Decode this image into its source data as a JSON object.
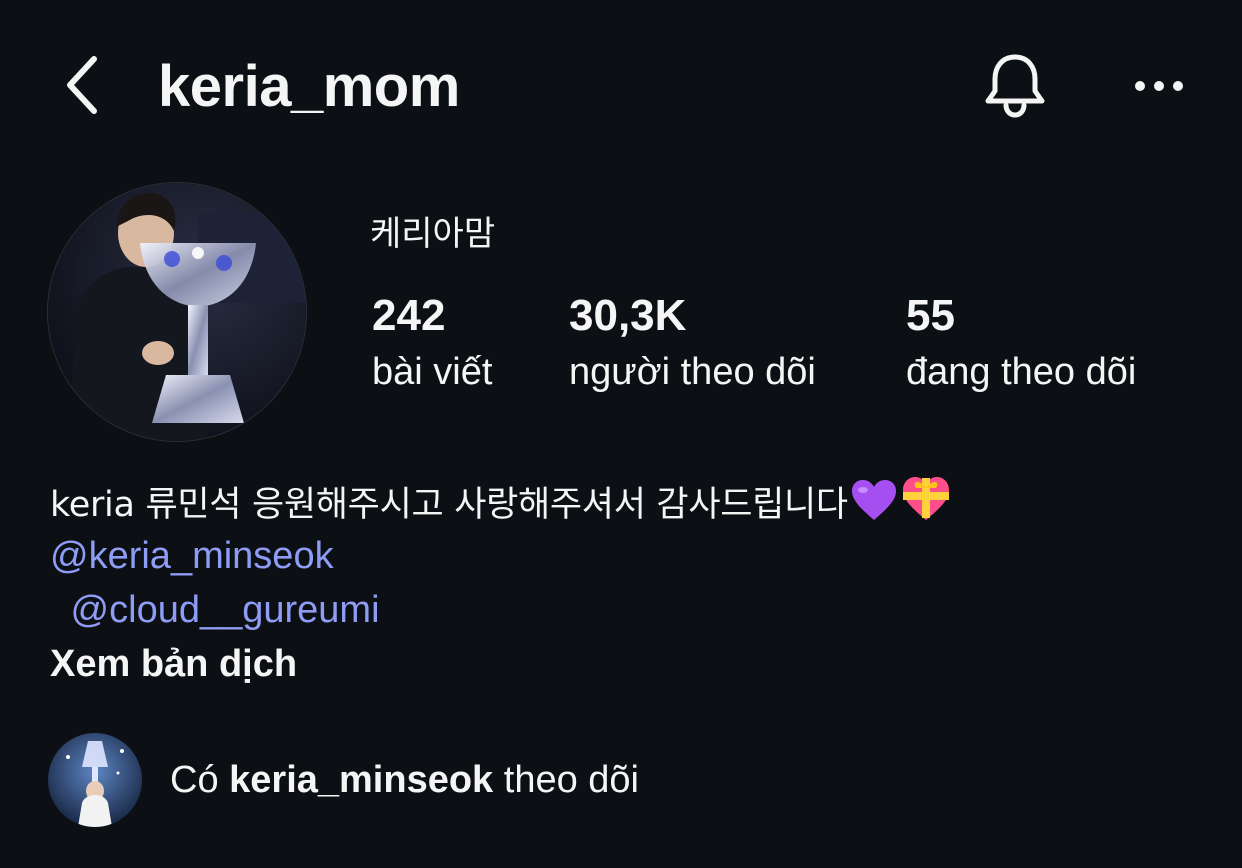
{
  "header": {
    "username": "keria_mom",
    "back_icon": "chevron-left-icon",
    "bell_icon": "bell-icon",
    "more_icon": "more-horizontal-icon"
  },
  "profile": {
    "display_name": "케리아맘",
    "stats": {
      "posts_count": "242",
      "posts_label": "bài viết",
      "followers_count": "30,3K",
      "followers_label": "người theo dõi",
      "following_count": "55",
      "following_label": "đang theo dõi"
    }
  },
  "bio": {
    "text": "keria 류민석 응원해주시고 사랑해주셔서 감사드립니다",
    "emoji_1": "purple-heart-icon",
    "emoji_2": "heart-with-ribbon-icon",
    "mention_1": "@keria_minseok",
    "mention_2": " @cloud__gureumi",
    "translate_label": "Xem bản dịch"
  },
  "followed_by": {
    "prefix": "Có",
    "username": "keria_minseok",
    "suffix": "theo dõi"
  },
  "colors": {
    "background": "#0c1014",
    "text": "#f5f5f5",
    "mention": "#8e9cf5"
  }
}
